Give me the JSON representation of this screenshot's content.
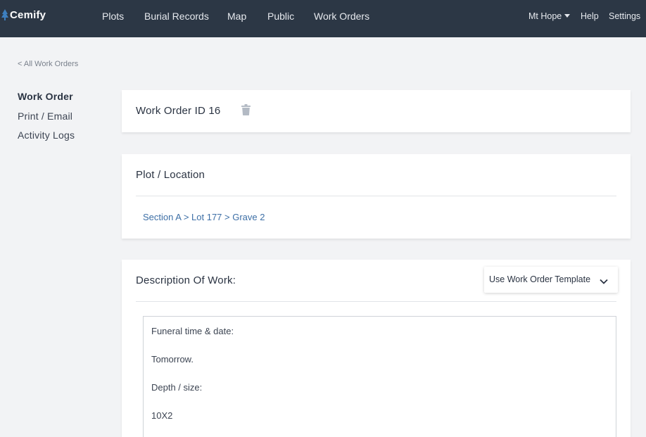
{
  "header": {
    "logo_text": "Cemify",
    "nav": [
      "Plots",
      "Burial Records",
      "Map",
      "Public",
      "Work Orders"
    ],
    "cemetery": "Mt Hope",
    "help": "Help",
    "settings": "Settings"
  },
  "back_link": "< All Work Orders",
  "sidebar": {
    "items": [
      {
        "label": "Work Order",
        "active": true
      },
      {
        "label": "Print / Email",
        "active": false
      },
      {
        "label": "Activity Logs",
        "active": false
      }
    ]
  },
  "work_order": {
    "title": "Work Order ID 16",
    "icon": "trash-icon"
  },
  "plot": {
    "heading": "Plot / Location",
    "path": "Section A > Lot 177 > Grave 2"
  },
  "description": {
    "heading": "Description Of Work:",
    "template_button": "Use Work Order Template",
    "lines": [
      "Funeral time & date:",
      "Tomorrow.",
      "Depth / size:",
      "10X2"
    ]
  },
  "colors": {
    "topbar": "#2c3745",
    "link": "#3d6fa6",
    "background": "#f2f3f5"
  }
}
